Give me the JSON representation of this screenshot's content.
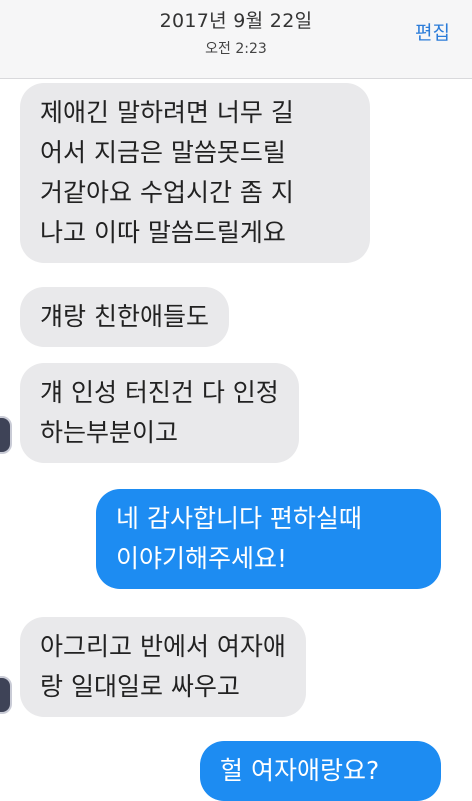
{
  "header": {
    "date": "2017년 9월 22일",
    "time": "오전 2:23",
    "edit_label": "편집"
  },
  "messages": [
    {
      "direction": "incoming",
      "lines": [
        "제애긴 말하려면 너무 길",
        "어서 지금은 말씀못드릴",
        "거같아요 수업시간 좀 지",
        "나고 이따 말씀드릴게요"
      ]
    },
    {
      "direction": "incoming",
      "lines": [
        "걔랑 친한애들도"
      ]
    },
    {
      "direction": "incoming",
      "lines": [
        "걔 인성 터진건 다 인정",
        "하는부분이고"
      ]
    },
    {
      "direction": "outgoing",
      "lines": [
        "네 감사합니다 편하실때",
        "이야기해주세요!"
      ]
    },
    {
      "direction": "incoming",
      "lines": [
        "아그리고 반에서 여자애",
        "랑 일대일로 싸우고"
      ]
    },
    {
      "direction": "outgoing",
      "lines": [
        "헐 여자애랑요?"
      ]
    }
  ],
  "colors": {
    "incoming_bubble": "#e9e9eb",
    "outgoing_bubble": "#1d8cf2",
    "accent": "#2b7cd9"
  }
}
